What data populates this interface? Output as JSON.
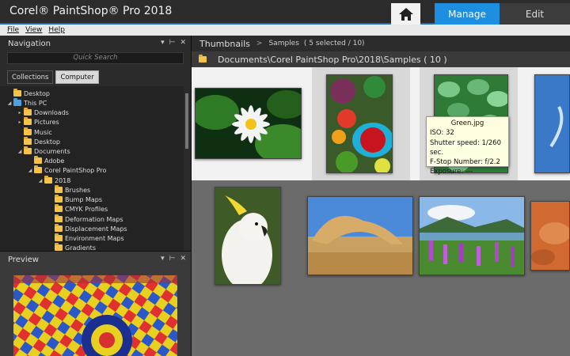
{
  "app": {
    "title": "Corel® PaintShop® Pro 2018"
  },
  "header": {
    "tab_manage": "Manage",
    "tab_edit": "Edit"
  },
  "menu": {
    "file": "File",
    "view": "View",
    "help": "Help"
  },
  "navigation": {
    "title": "Navigation",
    "search_placeholder": "Quick Search",
    "tabs": {
      "collections": "Collections",
      "computer": "Computer"
    },
    "tree": [
      {
        "label": "Desktop"
      },
      {
        "label": "This PC"
      },
      {
        "label": "Downloads"
      },
      {
        "label": "Pictures"
      },
      {
        "label": "Music"
      },
      {
        "label": "Desktop"
      },
      {
        "label": "Documents"
      },
      {
        "label": "Adobe"
      },
      {
        "label": "Corel PaintShop Pro"
      },
      {
        "label": "2018"
      },
      {
        "label": "Brushes"
      },
      {
        "label": "Bump Maps"
      },
      {
        "label": "CMYK Profiles"
      },
      {
        "label": "Deformation Maps"
      },
      {
        "label": "Displacement Maps"
      },
      {
        "label": "Environment Maps"
      },
      {
        "label": "Gradients"
      }
    ]
  },
  "preview": {
    "title": "Preview"
  },
  "main": {
    "breadcrumb_root": "Thumbnails",
    "breadcrumb_folder": "Samples",
    "breadcrumb_count": "( 5 selected / 10)",
    "path": "Documents\\Corel PaintShop Pro\\2018\\Samples ( 10 )"
  },
  "tooltip": {
    "filename": "Green.jpg",
    "iso": "ISO: 32",
    "shutter": "Shutter speed:  1/260 sec.",
    "fstop": "F-Stop Number: f/2.2",
    "exposure": "Exposure: ---"
  },
  "colors": {
    "accent": "#1e8ee0",
    "folder": "#f3c34a"
  },
  "icons": {
    "home": "home-icon",
    "folder": "folder-icon",
    "pin": "pin-icon",
    "close": "close-icon"
  }
}
